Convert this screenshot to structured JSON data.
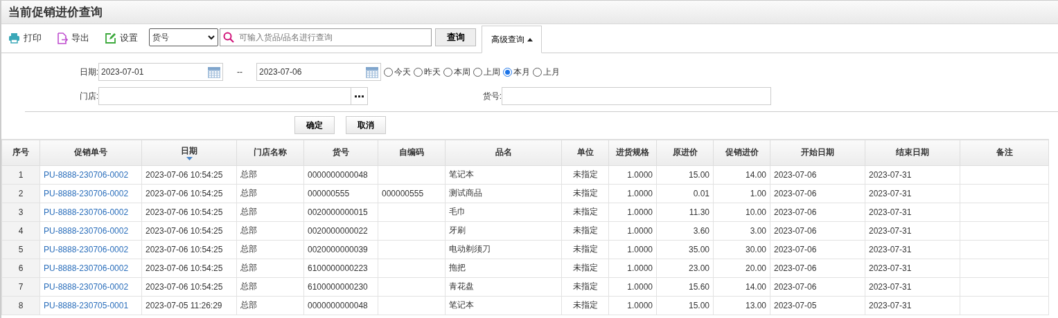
{
  "title": "当前促销进价查询",
  "toolbar": [
    {
      "kind": "print",
      "label": "打印"
    },
    {
      "kind": "export",
      "label": "导出"
    },
    {
      "kind": "settings",
      "label": "设置"
    }
  ],
  "search": {
    "field": "货号",
    "placeholder": "可输入货品/品名进行查询",
    "button": "查询"
  },
  "advanced": {
    "label": "高级查询",
    "expanded": true
  },
  "filters": {
    "date_label": "日期:",
    "date_from": "2023-07-01",
    "date_separator": "--",
    "date_to": "2023-07-06",
    "quick_ranges": [
      {
        "label": "今天",
        "selected": false
      },
      {
        "label": "昨天",
        "selected": false
      },
      {
        "label": "本周",
        "selected": false
      },
      {
        "label": "上周",
        "selected": false
      },
      {
        "label": "本月",
        "selected": true
      },
      {
        "label": "上月",
        "selected": false
      }
    ],
    "store_label": "门店:",
    "code_label": "货号:",
    "confirm": "确定",
    "cancel": "取消"
  },
  "table": {
    "columns": [
      {
        "label": "序号",
        "sorted_desc": false
      },
      {
        "label": "促销单号",
        "sorted_desc": false
      },
      {
        "label": "日期",
        "sorted_desc": true
      },
      {
        "label": "门店名称",
        "sorted_desc": false
      },
      {
        "label": "货号",
        "sorted_desc": false
      },
      {
        "label": "自编码",
        "sorted_desc": false
      },
      {
        "label": "品名",
        "sorted_desc": false
      },
      {
        "label": "单位",
        "sorted_desc": false
      },
      {
        "label": "进货规格",
        "sorted_desc": false
      },
      {
        "label": "原进价",
        "sorted_desc": false
      },
      {
        "label": "促销进价",
        "sorted_desc": false
      },
      {
        "label": "开始日期",
        "sorted_desc": false
      },
      {
        "label": "结束日期",
        "sorted_desc": false
      },
      {
        "label": "备注",
        "sorted_desc": false
      }
    ],
    "rows": [
      [
        "1",
        "PU-8888-230706-0002",
        "2023-07-06 10:54:25",
        "总部",
        "0000000000048",
        "",
        "笔记本",
        "未指定",
        "1.0000",
        "15.00",
        "14.00",
        "2023-07-06",
        "2023-07-31",
        ""
      ],
      [
        "2",
        "PU-8888-230706-0002",
        "2023-07-06 10:54:25",
        "总部",
        "000000555",
        "000000555",
        "测试商品",
        "未指定",
        "1.0000",
        "0.01",
        "1.00",
        "2023-07-06",
        "2023-07-31",
        ""
      ],
      [
        "3",
        "PU-8888-230706-0002",
        "2023-07-06 10:54:25",
        "总部",
        "0020000000015",
        "",
        "毛巾",
        "未指定",
        "1.0000",
        "11.30",
        "10.00",
        "2023-07-06",
        "2023-07-31",
        ""
      ],
      [
        "4",
        "PU-8888-230706-0002",
        "2023-07-06 10:54:25",
        "总部",
        "0020000000022",
        "",
        "牙刷",
        "未指定",
        "1.0000",
        "3.60",
        "3.00",
        "2023-07-06",
        "2023-07-31",
        ""
      ],
      [
        "5",
        "PU-8888-230706-0002",
        "2023-07-06 10:54:25",
        "总部",
        "0020000000039",
        "",
        "电动剃须刀",
        "未指定",
        "1.0000",
        "35.00",
        "30.00",
        "2023-07-06",
        "2023-07-31",
        ""
      ],
      [
        "6",
        "PU-8888-230706-0002",
        "2023-07-06 10:54:25",
        "总部",
        "6100000000223",
        "",
        "拖把",
        "未指定",
        "1.0000",
        "23.00",
        "20.00",
        "2023-07-06",
        "2023-07-31",
        ""
      ],
      [
        "7",
        "PU-8888-230706-0002",
        "2023-07-06 10:54:25",
        "总部",
        "6100000000230",
        "",
        "青花盘",
        "未指定",
        "1.0000",
        "15.60",
        "14.00",
        "2023-07-06",
        "2023-07-31",
        ""
      ],
      [
        "8",
        "PU-8888-230705-0001",
        "2023-07-05 11:26:29",
        "总部",
        "0000000000048",
        "",
        "笔记本",
        "未指定",
        "1.0000",
        "15.00",
        "13.00",
        "2023-07-05",
        "2023-07-31",
        ""
      ]
    ]
  }
}
